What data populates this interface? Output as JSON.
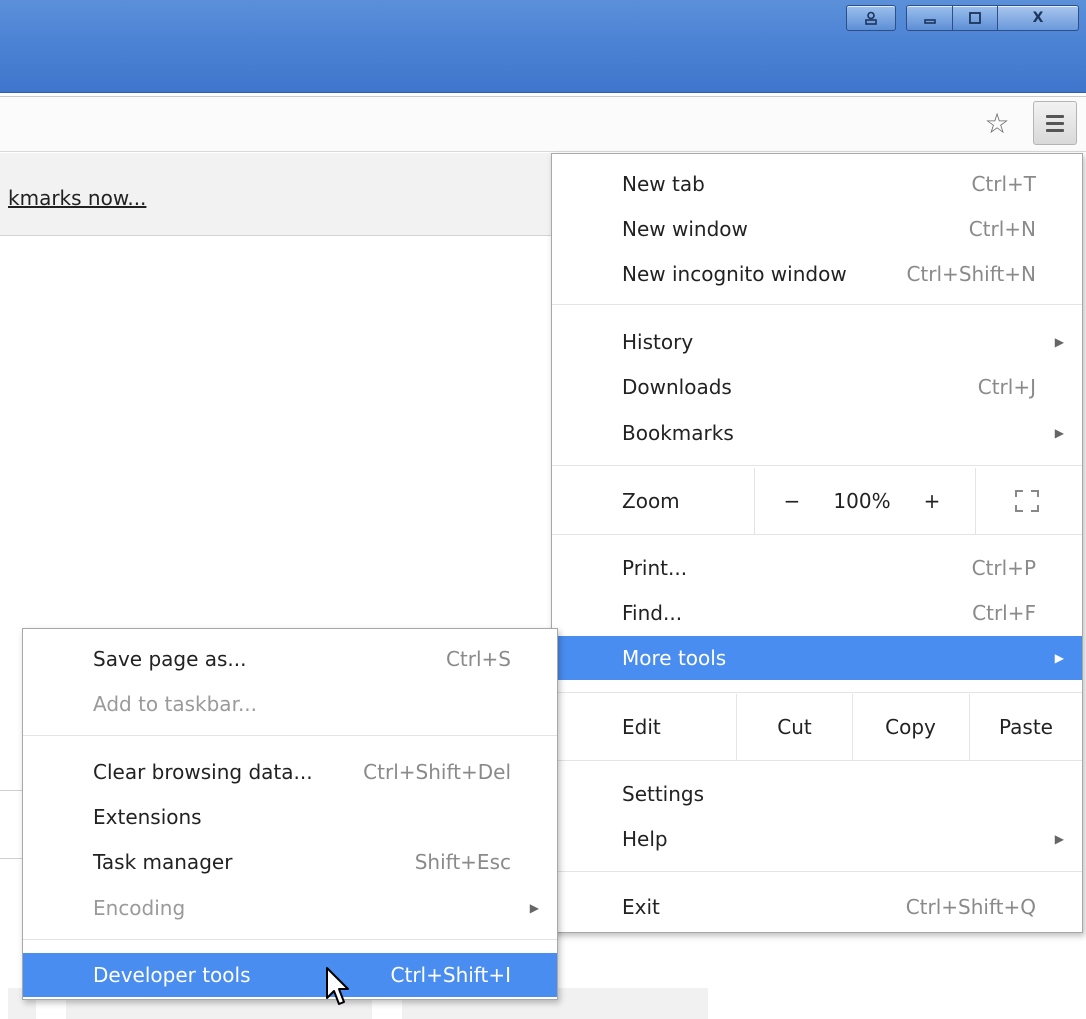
{
  "window": {
    "profile_icon": "person-icon",
    "minimize_icon": "minimize-icon",
    "maximize_icon": "maximize-icon",
    "close_label": "X"
  },
  "toolbar": {
    "bookmark_icon": "star-icon",
    "menu_icon": "hamburger-menu-icon"
  },
  "bookmarks_bar": {
    "link_text": "kmarks now..."
  },
  "menu": {
    "new_tab": {
      "label": "New tab",
      "shortcut": "Ctrl+T"
    },
    "new_window": {
      "label": "New window",
      "shortcut": "Ctrl+N"
    },
    "new_incognito": {
      "label": "New incognito window",
      "shortcut": "Ctrl+Shift+N"
    },
    "history": {
      "label": "History"
    },
    "downloads": {
      "label": "Downloads",
      "shortcut": "Ctrl+J"
    },
    "bookmarks": {
      "label": "Bookmarks"
    },
    "zoom": {
      "label": "Zoom",
      "minus": "−",
      "value": "100%",
      "plus": "+",
      "fullscreen_icon": "fullscreen-icon"
    },
    "print": {
      "label": "Print...",
      "shortcut": "Ctrl+P"
    },
    "find": {
      "label": "Find...",
      "shortcut": "Ctrl+F"
    },
    "more_tools": {
      "label": "More tools"
    },
    "edit": {
      "label": "Edit",
      "cut": "Cut",
      "copy": "Copy",
      "paste": "Paste"
    },
    "settings": {
      "label": "Settings"
    },
    "help": {
      "label": "Help"
    },
    "exit": {
      "label": "Exit",
      "shortcut": "Ctrl+Shift+Q"
    }
  },
  "submenu": {
    "save_page": {
      "label": "Save page as...",
      "shortcut": "Ctrl+S"
    },
    "add_taskbar": {
      "label": "Add to taskbar..."
    },
    "clear_data": {
      "label": "Clear browsing data...",
      "shortcut": "Ctrl+Shift+Del"
    },
    "extensions": {
      "label": "Extensions"
    },
    "task_manager": {
      "label": "Task manager",
      "shortcut": "Shift+Esc"
    },
    "encoding": {
      "label": "Encoding"
    },
    "developer_tools": {
      "label": "Developer tools",
      "shortcut": "Ctrl+Shift+I"
    }
  },
  "colors": {
    "highlight": "#4a8df0",
    "titlebar": "#4d83d4"
  }
}
